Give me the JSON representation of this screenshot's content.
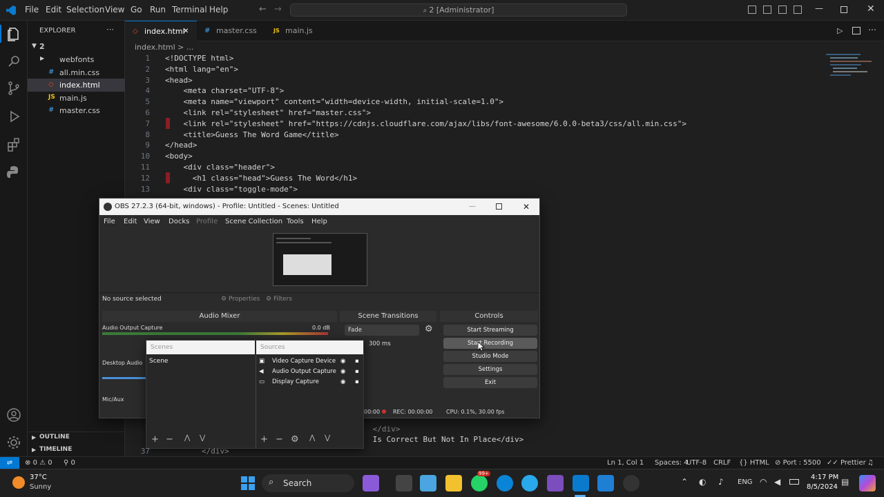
{
  "titlebar": {
    "menu": [
      "File",
      "Edit",
      "Selection",
      "View",
      "Go",
      "Run",
      "Terminal",
      "Help"
    ],
    "command_center": "2 [Administrator]"
  },
  "sidebar": {
    "title": "EXPLORER",
    "folder": "2",
    "items": [
      "webfonts",
      "all.min.css",
      "index.html",
      "main.js",
      "master.css"
    ],
    "outline": "OUTLINE",
    "timeline": "TIMELINE"
  },
  "tabs": [
    "index.html",
    "master.css",
    "main.js"
  ],
  "breadcrumb": "index.html > ...",
  "code_lines": [
    {
      "n": "1",
      "t": "<!DOCTYPE html>"
    },
    {
      "n": "2",
      "t": "<html lang=\"en\">"
    },
    {
      "n": "3",
      "t": "<head>"
    },
    {
      "n": "4",
      "t": "    <meta charset=\"UTF-8\">"
    },
    {
      "n": "5",
      "t": "    <meta name=\"viewport\" content=\"width=device-width, initial-scale=1.0\">"
    },
    {
      "n": "6",
      "t": "    <link rel=\"stylesheet\" href=\"master.css\">"
    },
    {
      "n": "7",
      "t": "    <link rel=\"stylesheet\" href=\"https://cdnjs.cloudflare.com/ajax/libs/font-awesome/6.0.0-beta3/css/all.min.css\">"
    },
    {
      "n": "8",
      "t": "    <title>Guess The Word Game</title>"
    },
    {
      "n": "9",
      "t": "</head>"
    },
    {
      "n": "10",
      "t": "<body>"
    },
    {
      "n": "11",
      "t": "    <div class=\"header\">"
    },
    {
      "n": "12",
      "t": "      <h1 class=\"head\">Guess The Word</h1>"
    },
    {
      "n": "13",
      "t": "    <div class=\"toggle-mode\">"
    }
  ],
  "bottom_code": [
    {
      "n": "",
      "t": "                              </div>"
    },
    {
      "n": "",
      "t": "                              Is Correct But Not In Place</div>"
    },
    {
      "n": "37",
      "t": "        </div>"
    }
  ],
  "status": {
    "errors": "0",
    "warnings": "0",
    "ports": "0",
    "position": "Ln 1, Col 1",
    "spaces": "Spaces: 4",
    "encoding": "UTF-8",
    "eol": "CRLF",
    "language": "HTML",
    "port": "Port : 5500",
    "formatter": "Prettier"
  },
  "obs": {
    "title": "OBS 27.2.3 (64-bit, windows) - Profile: Untitled - Scenes: Untitled",
    "menu": [
      "File",
      "Edit",
      "View",
      "Docks",
      "Profile",
      "Scene Collection",
      "Tools",
      "Help"
    ],
    "no_source": "No source selected",
    "properties": "Properties",
    "filters": "Filters",
    "audio_mixer": "Audio Mixer",
    "scene_transitions": "Scene Transitions",
    "controls": "Controls",
    "mixer": [
      {
        "name": "Audio Output Capture",
        "db": "0.0 dB"
      },
      {
        "name": "Desktop Audio"
      },
      {
        "name": "Mic/Aux"
      }
    ],
    "transition": "Fade",
    "duration": "300 ms",
    "controls_buttons": [
      "Start Streaming",
      "Start Recording",
      "Studio Mode",
      "Settings",
      "Exit"
    ],
    "stats": {
      "live": "00:00",
      "rec": "REC: 00:00:00",
      "cpu": "CPU: 0.1%, 30.00 fps"
    },
    "scenes_title": "Scenes",
    "sources_title": "Sources",
    "scene": "Scene",
    "sources": [
      "Video Capture Device",
      "Audio Output Capture",
      "Display Capture"
    ]
  },
  "taskbar": {
    "temp": "37°C",
    "weather": "Sunny",
    "search": "Search",
    "lang": "ENG",
    "time": "4:17 PM",
    "date": "8/5/2024",
    "badge": "99+"
  }
}
